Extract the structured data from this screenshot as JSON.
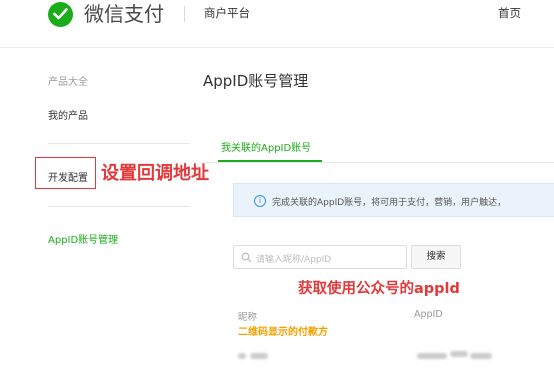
{
  "header": {
    "brand": "微信支付",
    "platform": "商户平台",
    "home": "首页"
  },
  "sidebar": {
    "category": "产品大全",
    "items": [
      {
        "label": "我的产品"
      },
      {
        "label": "开发配置"
      },
      {
        "label": "AppID账号管理"
      }
    ]
  },
  "main": {
    "title": "AppID账号管理",
    "tab_active": "我关联的AppID账号",
    "notice": "完成关联的AppID账号，将可用于支付，营销，用户触达，",
    "search_placeholder": "请输入昵称/AppID",
    "search_button": "搜索",
    "table_headers": [
      "昵称",
      "AppID"
    ]
  },
  "annotations": {
    "callback": "设置回调地址",
    "appid": "获取使用公众号的appld",
    "qr_payee": "二维码显示的付款方"
  },
  "colors": {
    "brand_green": "#1aad19",
    "annotation_red": "#e23a3a",
    "annotation_orange": "#f5a000",
    "info_blue": "#3e8ee6"
  }
}
